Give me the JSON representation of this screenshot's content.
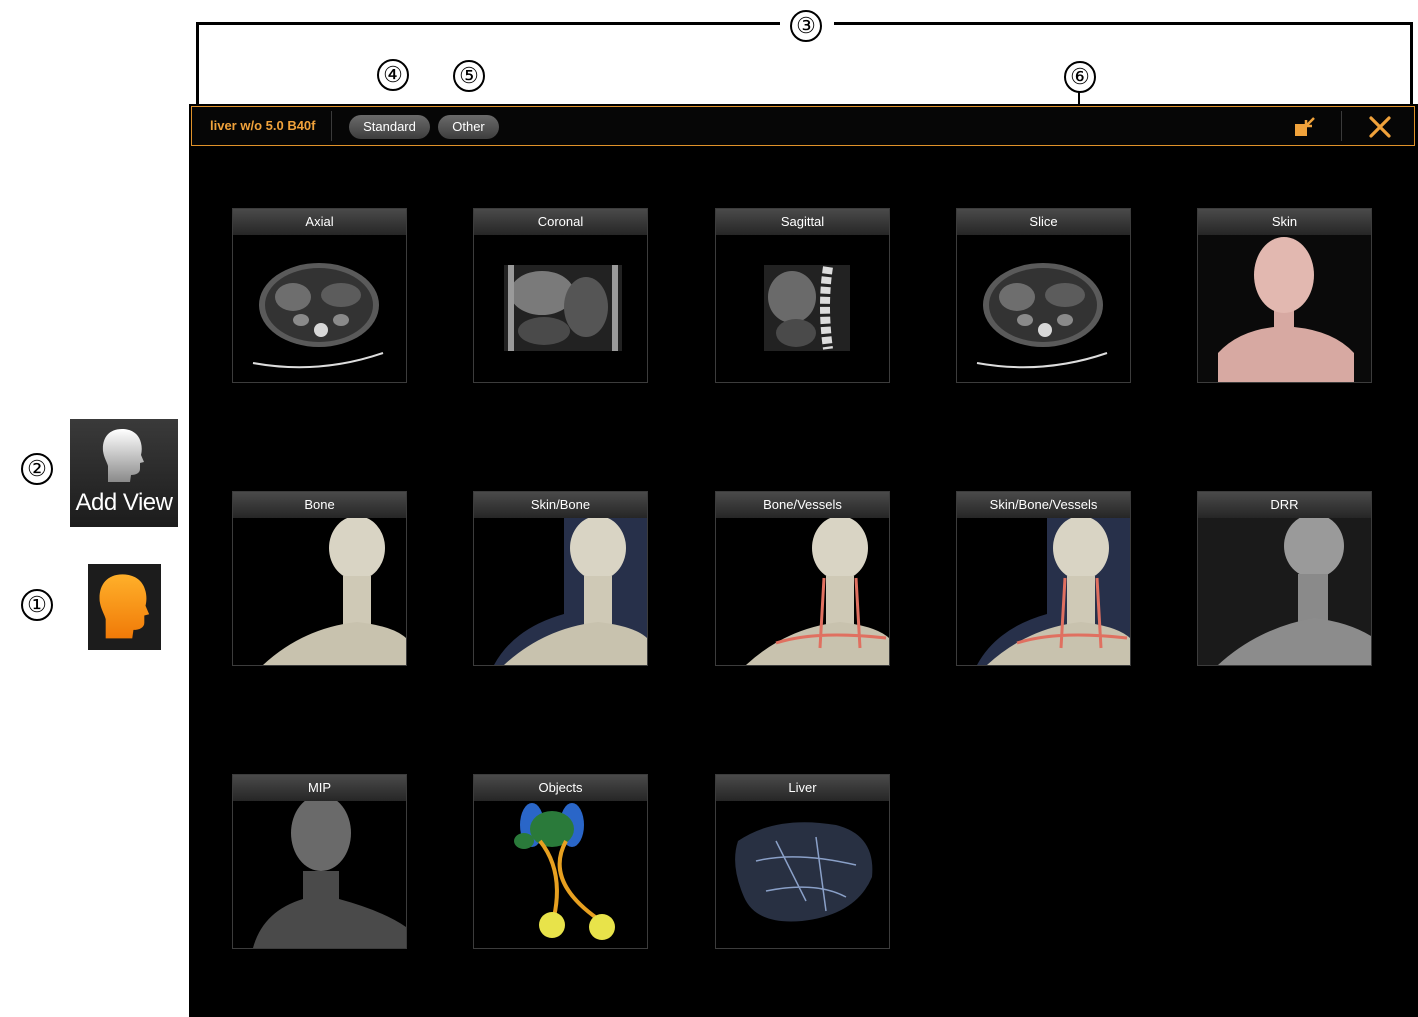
{
  "callouts": [
    "①",
    "②",
    "③",
    "④",
    "⑤",
    "⑥"
  ],
  "sidebar": {
    "add_view_label": "Add View"
  },
  "toolbar": {
    "dataset_title": "liver w/o 5.0 B40f",
    "tabs": [
      {
        "label": "Standard"
      },
      {
        "label": "Other"
      }
    ]
  },
  "colors": {
    "accent": "#f0a23b",
    "border_accent": "#e0922a",
    "background": "#000000"
  },
  "views": [
    {
      "label": "Axial",
      "icon": "axial-ct-thumbnail"
    },
    {
      "label": "Coronal",
      "icon": "coronal-ct-thumbnail"
    },
    {
      "label": "Sagittal",
      "icon": "sagittal-ct-thumbnail"
    },
    {
      "label": "Slice",
      "icon": "slice-ct-thumbnail"
    },
    {
      "label": "Skin",
      "icon": "skin-render-thumbnail"
    },
    {
      "label": "Bone",
      "icon": "bone-render-thumbnail"
    },
    {
      "label": "Skin/Bone",
      "icon": "skin-bone-render-thumbnail"
    },
    {
      "label": "Bone/Vessels",
      "icon": "bone-vessels-render-thumbnail"
    },
    {
      "label": "Skin/Bone/Vessels",
      "icon": "skin-bone-vessels-render-thumbnail"
    },
    {
      "label": "DRR",
      "icon": "drr-thumbnail"
    },
    {
      "label": "MIP",
      "icon": "mip-thumbnail"
    },
    {
      "label": "Objects",
      "icon": "objects-render-thumbnail"
    },
    {
      "label": "Liver",
      "icon": "liver-render-thumbnail"
    }
  ]
}
